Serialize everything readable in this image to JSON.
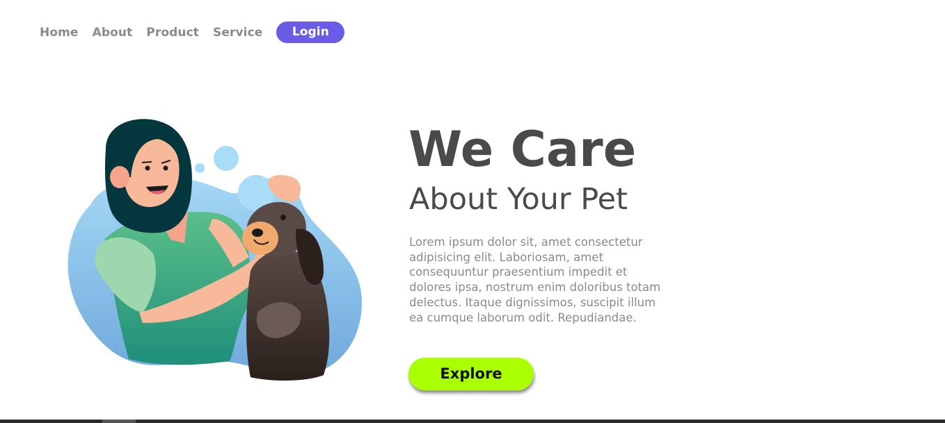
{
  "nav": {
    "items": [
      {
        "label": "Home"
      },
      {
        "label": "About"
      },
      {
        "label": "Product"
      },
      {
        "label": "Service"
      }
    ],
    "login_label": "Login"
  },
  "hero": {
    "title": "We Care",
    "subtitle": "About Your Pet",
    "body": "Lorem ipsum dolor sit, amet consectetur adipisicing elit. Laboriosam, amet consequuntur praesentium impedit et dolores ipsa, nostrum enim doloribus totam delectus. Itaque dignissimos, suscipit illum ea cumque laborum odit. Repudiandae.",
    "cta_label": "Explore"
  },
  "colors": {
    "accent": "#6b5ce7",
    "cta": "#aaff00",
    "heading": "#4a4a4a",
    "muted": "#8a8a8a"
  },
  "illustration": {
    "icon": "vet-woman-with-dog-illustration"
  }
}
